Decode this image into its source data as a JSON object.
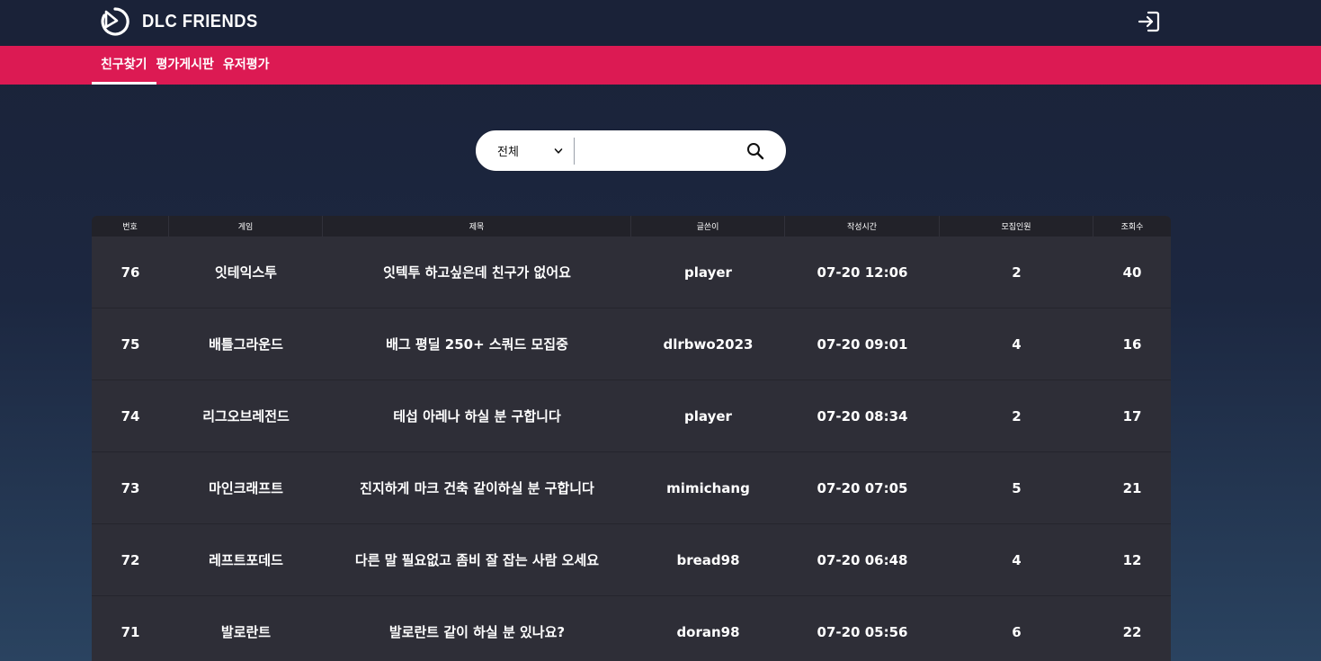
{
  "header": {
    "logo_text": "DLC FRIENDS",
    "login_icon": "login-icon"
  },
  "nav": {
    "tabs": [
      {
        "label": "친구찾기",
        "active": true
      },
      {
        "label": "평가게시판",
        "active": false
      },
      {
        "label": "유저평가",
        "active": false
      }
    ]
  },
  "search": {
    "select_value": "전체",
    "input_value": "",
    "icon": "search-icon"
  },
  "table": {
    "columns": [
      "번호",
      "게임",
      "제목",
      "글쓴이",
      "작성시간",
      "모집인원",
      "조회수"
    ],
    "rows": [
      [
        "76",
        "잇테익스투",
        "잇텍투 하고싶은데 친구가 없어요",
        "player",
        "07-20 12:06",
        "2",
        "40"
      ],
      [
        "75",
        "배틀그라운드",
        "배그 평딜 250+ 스쿼드 모집중",
        "dlrbwo2023",
        "07-20 09:01",
        "4",
        "16"
      ],
      [
        "74",
        "리그오브레전드",
        "테섭 아레나 하실 분 구합니다",
        "player",
        "07-20 08:34",
        "2",
        "17"
      ],
      [
        "73",
        "마인크래프트",
        "진지하게 마크 건축 같이하실 분 구합니다",
        "mimichang",
        "07-20 07:05",
        "5",
        "21"
      ],
      [
        "72",
        "레프트포데드",
        "다른 말 필요없고 좀비 잘 잡는 사람 오세요",
        "bread98",
        "07-20 06:48",
        "4",
        "12"
      ],
      [
        "71",
        "발로란트",
        "발로란트 같이 하실 분 있나요?",
        "doran98",
        "07-20 05:56",
        "6",
        "22"
      ]
    ]
  },
  "colors": {
    "header_bg": "#1a2238",
    "nav_bg": "#dc1a53",
    "table_bg": "#2e2e37",
    "table_head_bg": "#222229"
  }
}
